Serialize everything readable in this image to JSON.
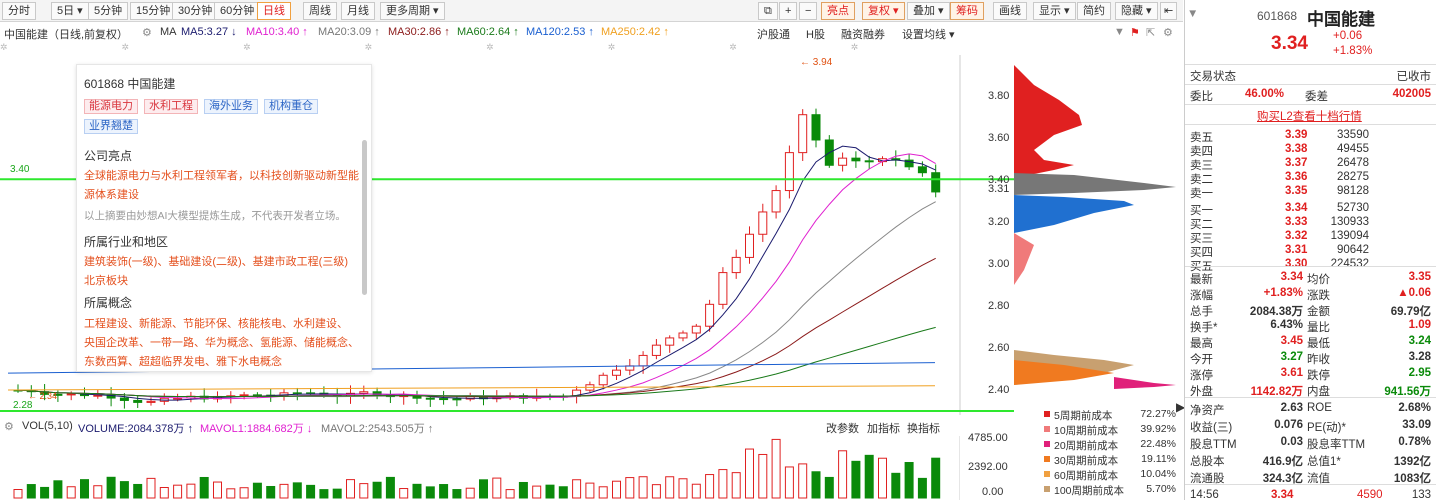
{
  "toolbar": {
    "tabs": [
      "分时",
      "5日 ▾",
      "5分钟",
      "15分钟",
      "30分钟",
      "60分钟",
      "日线",
      "周线",
      "月线",
      "更多周期 ▾"
    ],
    "right": [
      "亮点",
      "复权 ▾",
      "叠加 ▾",
      "筹码",
      "画线",
      "显示 ▾",
      "简约",
      "隐藏 ▾"
    ],
    "icons": [
      "⧉",
      "+",
      "−"
    ]
  },
  "ma": {
    "title": "中国能建（日线,前复权）",
    "ma": "MA",
    "ma5": "MA5:3.27 ↓",
    "ma10": "MA10:3.40 ↑",
    "ma20": "MA20:3.09 ↑",
    "ma30": "MA30:2.86 ↑",
    "ma60": "MA60:2.64 ↑",
    "ma120": "MA120:2.53 ↑",
    "ma250": "MA250:2.42 ↑",
    "links": [
      "沪股通",
      "H股",
      "融资融券",
      "设置均线 ▾"
    ]
  },
  "price_labels": [
    "3.80",
    "3.60",
    "3.40",
    "3.20",
    "3.00",
    "2.80",
    "2.60",
    "2.40"
  ],
  "current_price_label": "3.31",
  "line_label_left": "3.40",
  "high_marker": "3.94",
  "low_marker": "2.28",
  "low_marker2": "2.34",
  "colors": {
    "up": "#e02020",
    "down": "#0a8a0a",
    "ma5": "#1b1b6e",
    "ma10": "#e020d0",
    "ma20": "#888888",
    "ma30": "#8b1a1a",
    "ma60": "#1a7a1a",
    "ma120": "#1a5fd0",
    "ma250": "#f0a020",
    "line": "#2ee82e"
  },
  "info": {
    "code": "601868 中国能建",
    "tags": [
      "能源电力",
      "水利工程",
      "海外业务",
      "机构重仓",
      "业界翘楚"
    ],
    "h1": "公司亮点",
    "highlight1": "全球能源电力与水利工程领军者，以科技创新驱动新型能",
    "highlight2": "源体系建设",
    "note": "以上摘要由妙想AI大模型提炼生成，不代表开发者立场。",
    "h2": "所属行业和地区",
    "ind1": "建筑装饰(一级)、基础建设(二级)、基建市政工程(三级)",
    "ind2": "北京板块",
    "h3": "所属概念",
    "c1": "工程建设、新能源、节能环保、核能核电、水利建设、",
    "c2": "央国企改革、一带一路、华为概念、氢能源、储能概念、",
    "c3": "东数西算、超超临界发电、雅下水电概念"
  },
  "vol": {
    "label": "VOL(5,10)",
    "volume": "VOLUME:2084.378万 ↑",
    "mavol1": "MAVOL1:1884.682万 ↓",
    "mavol2": "MAVOL2:2543.505万 ↑",
    "links": [
      "改参数",
      "加指标",
      "换指标"
    ],
    "ticks": [
      "4785.00",
      "2392.00",
      "0.00"
    ]
  },
  "chips": {
    "legend": [
      {
        "name": "5周期前成本",
        "pct": "72.27%",
        "color": "#e02020"
      },
      {
        "name": "10周期前成本",
        "pct": "39.92%",
        "color": "#f07a7a"
      },
      {
        "name": "20周期前成本",
        "pct": "22.48%",
        "color": "#e0207a"
      },
      {
        "name": "30周期前成本",
        "pct": "19.11%",
        "color": "#f07a20"
      },
      {
        "name": "60周期前成本",
        "pct": "10.04%",
        "color": "#f0a040"
      },
      {
        "name": "100周期前成本",
        "pct": "5.70%",
        "color": "#c8a070"
      }
    ]
  },
  "quote": {
    "code": "601868",
    "name": "中国能建",
    "price": "3.34",
    "chg": "+0.06",
    "pct": "+1.83%",
    "status_label": "交易状态",
    "status": "已收市",
    "wb_label": "委比",
    "wb": "46.00%",
    "wc_label": "委差",
    "wc": "402005",
    "l2": "购买L2查看十档行情",
    "asks": [
      [
        "卖五",
        "3.39",
        "33590"
      ],
      [
        "卖四",
        "3.38",
        "49455"
      ],
      [
        "卖三",
        "3.37",
        "26478"
      ],
      [
        "卖二",
        "3.36",
        "28275"
      ],
      [
        "卖一",
        "3.35",
        "98128"
      ]
    ],
    "bids": [
      [
        "买一",
        "3.34",
        "52730"
      ],
      [
        "买二",
        "3.33",
        "130933"
      ],
      [
        "买三",
        "3.32",
        "139094"
      ],
      [
        "买四",
        "3.31",
        "90642"
      ],
      [
        "买五",
        "3.30",
        "224532"
      ]
    ],
    "stats": [
      [
        "最新",
        "3.34",
        "r",
        "均价",
        "3.35",
        "r"
      ],
      [
        "涨幅",
        "+1.83%",
        "r",
        "涨跌",
        "▲0.06",
        "r"
      ],
      [
        "总手",
        "2084.38万",
        "b",
        "金额",
        "69.79亿",
        "b"
      ],
      [
        "换手*",
        "6.43%",
        "b",
        "量比",
        "1.09",
        "r"
      ],
      [
        "最高",
        "3.45",
        "r",
        "最低",
        "3.24",
        "g"
      ],
      [
        "今开",
        "3.27",
        "g",
        "昨收",
        "3.28",
        "b"
      ],
      [
        "涨停",
        "3.61",
        "r",
        "跌停",
        "2.95",
        "g"
      ],
      [
        "外盘",
        "1142.82万",
        "r",
        "内盘",
        "941.56万",
        "g"
      ]
    ],
    "fin": [
      [
        "净资产",
        "2.63",
        "ROE",
        "2.68%"
      ],
      [
        "收益(三)",
        "0.076",
        "PE(动)*",
        "33.09"
      ],
      [
        "股息TTM",
        "0.03",
        "股息率TTM",
        "0.78%"
      ],
      [
        "总股本",
        "416.9亿",
        "总值1*",
        "1392亿"
      ],
      [
        "流通股",
        "324.3亿",
        "流值",
        "1083亿"
      ]
    ],
    "last": {
      "time": "14:56",
      "price": "3.34",
      "vol": "4590",
      "num": "133"
    }
  }
}
